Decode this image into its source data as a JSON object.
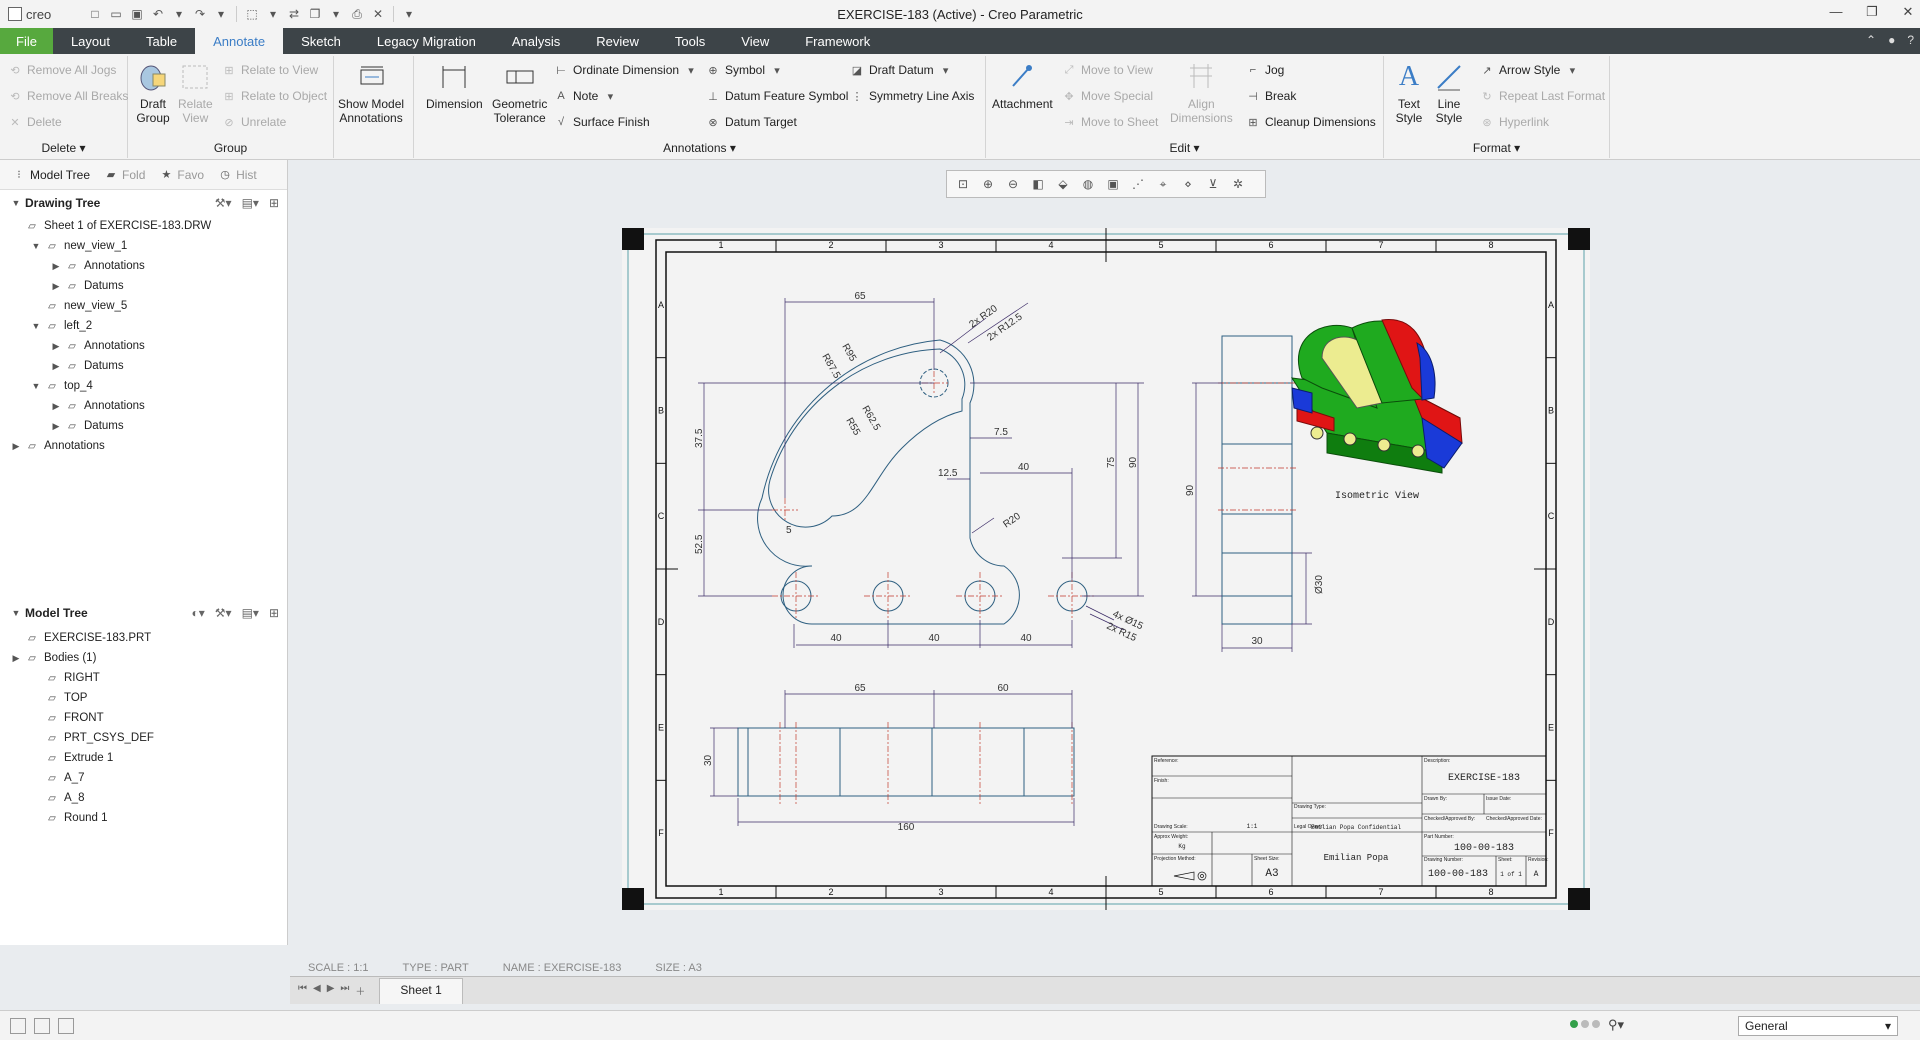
{
  "app": {
    "logo": "creo",
    "window_title": "EXERCISE-183 (Active) - Creo Parametric"
  },
  "menu": {
    "tabs": [
      "File",
      "Layout",
      "Table",
      "Annotate",
      "Sketch",
      "Legacy Migration",
      "Analysis",
      "Review",
      "Tools",
      "View",
      "Framework"
    ],
    "active": "Annotate"
  },
  "ribbon": {
    "delete": {
      "items": [
        "Remove All Jogs",
        "Remove All Breaks",
        "Delete"
      ],
      "label": "Delete"
    },
    "group": {
      "draft_group": "Draft\nGroup",
      "relate_view": "Relate\nView",
      "items": [
        "Relate to View",
        "Relate to Object",
        "Unrelate"
      ],
      "label": "Group"
    },
    "show_model": "Show Model\nAnnotations",
    "annotations": {
      "dimension": "Dimension",
      "geometric_tolerance": "Geometric\nTolerance",
      "col1": [
        "Ordinate Dimension",
        "Note",
        "Surface Finish"
      ],
      "col2": [
        "Symbol",
        "Datum Feature Symbol",
        "Datum Target"
      ],
      "col3": [
        "Draft Datum",
        "Symmetry Line Axis"
      ],
      "label": "Annotations"
    },
    "edit": {
      "attachment": "Attachment",
      "col1": [
        "Move to View",
        "Move Special",
        "Move to Sheet"
      ],
      "align": "Align\nDimensions",
      "col2": [
        "Jog",
        "Break",
        "Cleanup Dimensions"
      ],
      "label": "Edit"
    },
    "format": {
      "text_style": "Text\nStyle",
      "line_style": "Line\nStyle",
      "items": [
        "Arrow Style",
        "Repeat Last Format",
        "Hyperlink"
      ],
      "label": "Format"
    }
  },
  "panel": {
    "tabs": [
      "Model Tree",
      "Fold",
      "Favo",
      "Hist"
    ],
    "drawing_tree": {
      "title": "Drawing Tree",
      "nodes": [
        {
          "label": "Sheet 1 of EXERCISE-183.DRW",
          "indent": 0,
          "toggle": ""
        },
        {
          "label": "new_view_1",
          "indent": 1,
          "toggle": "▼"
        },
        {
          "label": "Annotations",
          "indent": 2,
          "toggle": "▶"
        },
        {
          "label": "Datums",
          "indent": 2,
          "toggle": "▶"
        },
        {
          "label": "new_view_5",
          "indent": 1,
          "toggle": ""
        },
        {
          "label": "left_2",
          "indent": 1,
          "toggle": "▼"
        },
        {
          "label": "Annotations",
          "indent": 2,
          "toggle": "▶"
        },
        {
          "label": "Datums",
          "indent": 2,
          "toggle": "▶"
        },
        {
          "label": "top_4",
          "indent": 1,
          "toggle": "▼"
        },
        {
          "label": "Annotations",
          "indent": 2,
          "toggle": "▶"
        },
        {
          "label": "Datums",
          "indent": 2,
          "toggle": "▶"
        },
        {
          "label": "Annotations",
          "indent": 0,
          "toggle": "▶"
        }
      ]
    },
    "model_tree": {
      "title": "Model Tree",
      "nodes": [
        {
          "label": "EXERCISE-183.PRT",
          "indent": 0,
          "toggle": ""
        },
        {
          "label": "Bodies (1)",
          "indent": 0,
          "toggle": "▶"
        },
        {
          "label": "RIGHT",
          "indent": 1,
          "toggle": ""
        },
        {
          "label": "TOP",
          "indent": 1,
          "toggle": ""
        },
        {
          "label": "FRONT",
          "indent": 1,
          "toggle": ""
        },
        {
          "label": "PRT_CSYS_DEF",
          "indent": 1,
          "toggle": ""
        },
        {
          "label": "Extrude 1",
          "indent": 1,
          "toggle": ""
        },
        {
          "label": "A_7",
          "indent": 1,
          "toggle": ""
        },
        {
          "label": "A_8",
          "indent": 1,
          "toggle": ""
        },
        {
          "label": "Round 1",
          "indent": 1,
          "toggle": ""
        }
      ]
    }
  },
  "drawing": {
    "cols": [
      "1",
      "2",
      "3",
      "4",
      "5",
      "6",
      "7",
      "8"
    ],
    "rows": [
      "A",
      "B",
      "C",
      "D",
      "E",
      "F"
    ],
    "front_dims": [
      "65",
      "2x R20",
      "2x R12.5",
      "R87.5",
      "R95",
      "R62.5",
      "R55",
      "37.5",
      "52.5",
      "5",
      "7.5",
      "12.5",
      "40",
      "R20",
      "75",
      "90",
      "40",
      "40",
      "40",
      "4x Ø15",
      "2x R15"
    ],
    "side_dims": [
      "90",
      "Ø30",
      "30"
    ],
    "top_dims": [
      "65",
      "60",
      "30",
      "160"
    ],
    "iso_label": "Isometric View",
    "title_block": {
      "description": "EXERCISE-183",
      "part_number": "100-00-183",
      "drawing_number": "100-00-183",
      "sheet_size": "A3",
      "scale": "1:1",
      "scale2": "1:1",
      "sheet": "1 of 1",
      "revision": "A",
      "author": "Emilian Popa",
      "confidential": "Emilian Popa Confidential",
      "mass": "Kg",
      "fields": [
        "Reference:",
        "Finish:",
        "Approx Weight:",
        "Projection Method:",
        "Description:",
        "Drawn By:",
        "Checked/Approved By:",
        "Part Number:",
        "Drawing Number:",
        "Sheet Size:",
        "Sheet:",
        "Revision:",
        "Drawing Scale:",
        "Drawing Type:",
        "Legal Owner:",
        "Issue Date:",
        "Checked/Approved Date:"
      ]
    }
  },
  "status": {
    "scale": "SCALE : 1:1",
    "type": "TYPE : PART",
    "name": "NAME : EXERCISE-183",
    "size": "SIZE : A3"
  },
  "sheet_tab": "Sheet 1",
  "filter": "General",
  "colors": {
    "file_tab": "#57a93e",
    "menubar": "#3d4448",
    "accent": "#3b7dc6",
    "drawing_line": "#2e5f80",
    "dim_line": "#3a2a66",
    "iso_green": "#1faa1f",
    "iso_red": "#e01515",
    "iso_blue": "#1a3ad8",
    "iso_yellow": "#ecec90"
  }
}
